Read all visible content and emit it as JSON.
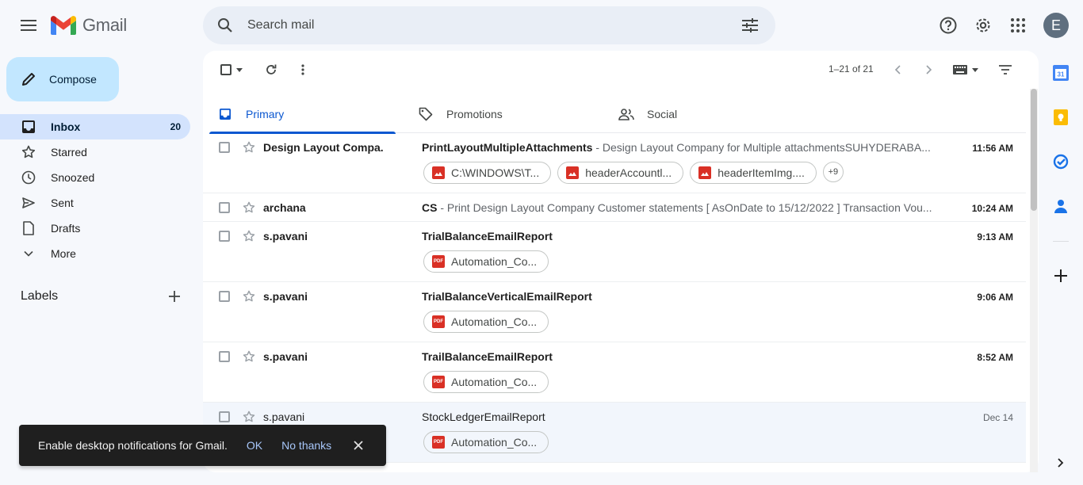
{
  "app": {
    "name": "Gmail",
    "avatar_letter": "E"
  },
  "search": {
    "placeholder": "Search mail"
  },
  "compose": {
    "label": "Compose"
  },
  "nav": [
    {
      "label": "Inbox",
      "count": "20",
      "icon": "inbox-icon"
    },
    {
      "label": "Starred",
      "count": "",
      "icon": "star-icon"
    },
    {
      "label": "Snoozed",
      "count": "",
      "icon": "clock-icon"
    },
    {
      "label": "Sent",
      "count": "",
      "icon": "send-icon"
    },
    {
      "label": "Drafts",
      "count": "",
      "icon": "draft-icon"
    },
    {
      "label": "More",
      "count": "",
      "icon": "chevron-down-icon"
    }
  ],
  "labels": {
    "title": "Labels"
  },
  "toolbar": {
    "pager": "1–21 of 21"
  },
  "tabs": [
    {
      "label": "Primary",
      "icon": "inbox-icon"
    },
    {
      "label": "Promotions",
      "icon": "tag-icon"
    },
    {
      "label": "Social",
      "icon": "people-icon"
    }
  ],
  "emails": [
    {
      "sender": "Design Layout Compa.",
      "subject": "PrintLayoutMultipleAttachments",
      "snippet": " - Design Layout Company for Multiple attachmentsSUHYDERABA...",
      "time": "11:56 AM",
      "read": false,
      "attachments": [
        {
          "name": "C:\\WINDOWS\\T...",
          "type": "image"
        },
        {
          "name": "headerAccountl...",
          "type": "image"
        },
        {
          "name": "headerItemImg....",
          "type": "image"
        }
      ],
      "more": "+9"
    },
    {
      "sender": "archana",
      "subject": "CS",
      "snippet": " - Print Design Layout Company Customer statements [ AsOnDate to 15/12/2022 ] Transaction Vou...",
      "time": "10:24 AM",
      "read": false,
      "attachments": []
    },
    {
      "sender": "s.pavani",
      "subject": "TrialBalanceEmailReport",
      "snippet": "",
      "time": "9:13 AM",
      "read": false,
      "attachments": [
        {
          "name": "Automation_Co...",
          "type": "pdf"
        }
      ]
    },
    {
      "sender": "s.pavani",
      "subject": "TrialBalanceVerticalEmailReport",
      "snippet": "",
      "time": "9:06 AM",
      "read": false,
      "attachments": [
        {
          "name": "Automation_Co...",
          "type": "pdf"
        }
      ]
    },
    {
      "sender": "s.pavani",
      "subject": "TrailBalanceEmailReport",
      "snippet": "",
      "time": "8:52 AM",
      "read": false,
      "attachments": [
        {
          "name": "Automation_Co...",
          "type": "pdf"
        }
      ]
    },
    {
      "sender": "s.pavani",
      "subject": "StockLedgerEmailReport",
      "snippet": "",
      "time": "Dec 14",
      "read": true,
      "attachments": [
        {
          "name": "Automation_Co...",
          "type": "pdf"
        }
      ]
    }
  ],
  "snackbar": {
    "message": "Enable desktop notifications for Gmail.",
    "ok": "OK",
    "no_thanks": "No thanks"
  },
  "side_panel": {
    "calendar_day": "31"
  },
  "colors": {
    "accent": "#0b57d0",
    "compose_bg": "#c2e7ff",
    "nav_active": "#d3e3fd",
    "pdf_red": "#d93025",
    "image_red": "#d93025"
  }
}
